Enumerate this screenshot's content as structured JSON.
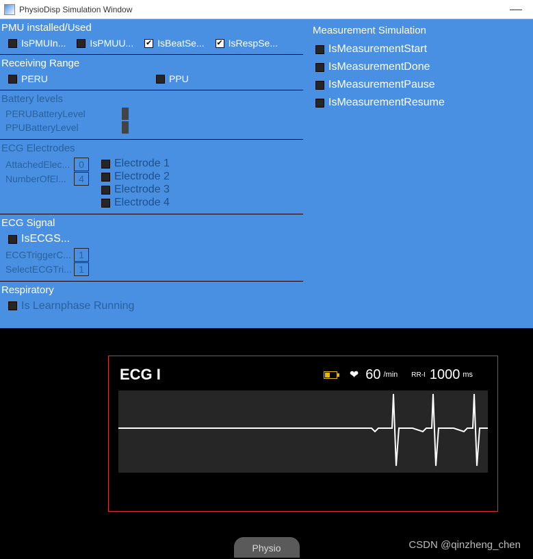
{
  "window": {
    "title": "PhysioDisp Simulation Window"
  },
  "pmu": {
    "title": "PMU installed/Used",
    "items": [
      {
        "label": "IsPMUIn...",
        "checked": false
      },
      {
        "label": "IsPMUU...",
        "checked": false
      },
      {
        "label": "IsBeatSe...",
        "checked": true
      },
      {
        "label": "IsRespSe...",
        "checked": true
      }
    ]
  },
  "receiving": {
    "title": "Receiving Range",
    "items": [
      {
        "label": "PERU",
        "checked": false
      },
      {
        "label": "PPU",
        "checked": false
      }
    ]
  },
  "battery": {
    "title": "Battery levels",
    "sliders": [
      {
        "label": "PERUBatteryLevel"
      },
      {
        "label": "PPUBatteryLevel"
      }
    ]
  },
  "electrodes": {
    "title": "ECG Electrodes",
    "nums": [
      {
        "label": "AttachedElec...",
        "value": "0"
      },
      {
        "label": "NumberOfEl...",
        "value": "4"
      }
    ],
    "items": [
      {
        "label": "Electrode 1",
        "checked": false
      },
      {
        "label": "Electrode 2",
        "checked": false
      },
      {
        "label": "Electrode 3",
        "checked": false
      },
      {
        "label": "Electrode 4",
        "checked": false
      }
    ]
  },
  "ecg_signal": {
    "title": "ECG Signal",
    "cb": {
      "label": "IsECGS...",
      "checked": false
    },
    "nums": [
      {
        "label": "ECGTriggerC...",
        "value": "1"
      },
      {
        "label": "SelectECGTri...",
        "value": "1"
      }
    ]
  },
  "respiratory": {
    "title": "Respiratory",
    "cb": {
      "label": "Is Learnphase Running",
      "checked": false
    }
  },
  "measurement": {
    "title": "Measurement Simulation",
    "items": [
      {
        "label": "IsMeasurementStart",
        "checked": false
      },
      {
        "label": "IsMeasurementDone",
        "checked": false
      },
      {
        "label": "IsMeasurementPause",
        "checked": false
      },
      {
        "label": "IsMeasurementResume",
        "checked": false
      }
    ]
  },
  "ecg_display": {
    "title": "ECG I",
    "rate": "60",
    "rate_unit": "/min",
    "rr_label": "RR-I",
    "rr_value": "1000",
    "rr_unit": "ms"
  },
  "bottom_button": "Physio",
  "watermark": "CSDN @qinzheng_chen"
}
